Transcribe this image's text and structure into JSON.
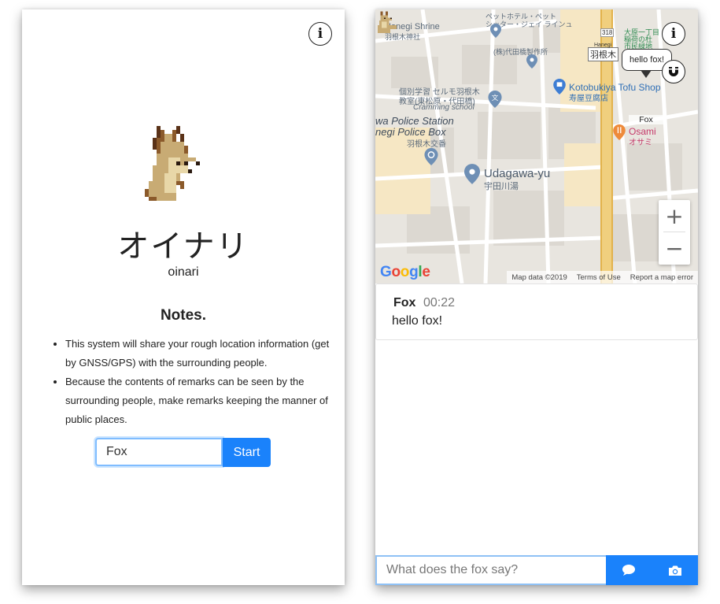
{
  "left_screen": {
    "title": "オイナリ",
    "subtitle": "oinari",
    "notes_heading": "Notes.",
    "notes": [
      "This system will share your rough location information (get by GNSS/GPS) with the surrounding people.",
      "Because the contents of remarks can be seen by the surrounding people, make remarks keeping the manner of public places."
    ],
    "name_input_value": "Fox",
    "start_label": "Start",
    "info_label": "i"
  },
  "right_screen": {
    "info_label": "i",
    "map": {
      "labels": {
        "hanegi_shrine": "Hanegi Shrine",
        "hanegi_shrine_jp": "羽根木神社",
        "hotel": "ペットホテル・ペット",
        "hotel2": "シッター・ジェイ ラインュ",
        "yoyogi": "(株)代田橋製作所",
        "hanegi_sign": "羽根木",
        "hanegi_small": "Hanegi",
        "school": "個別学習 セルモ羽根木",
        "school2": "教室(東松原・代田橋)",
        "school3": "Cramming school",
        "kotobukiya": "Kotobukiya Tofu Shop",
        "kotobukiya_jp": "寿屋豆腐店",
        "police1": "wa Police Station",
        "police2": "negi Police Box",
        "police_jp": "羽根木交番",
        "osami": "Osami",
        "osami_jp": "オサミ",
        "udagawa": "Udagawa-yu",
        "udagawa_jp": "宇田川湯",
        "route": "318",
        "ohara": "大原一丁目",
        "ohara2": "稲荷の杜",
        "ohara3": "市民緑地"
      },
      "bubble_text": "hello fox!",
      "marker_label": "Fox",
      "footer": [
        "Map data ©2019",
        "Terms of Use",
        "Report a map error"
      ],
      "google": [
        "G",
        "o",
        "o",
        "g",
        "l",
        "e"
      ],
      "google_colors": [
        "#4285F4",
        "#EA4335",
        "#FBBC05",
        "#4285F4",
        "#34A853",
        "#EA4335"
      ],
      "zoom_in": "+",
      "zoom_out": "−"
    },
    "message": {
      "name": "Fox",
      "time": "00:22",
      "text": "hello fox!"
    },
    "chat_placeholder": "What does the fox say?"
  }
}
